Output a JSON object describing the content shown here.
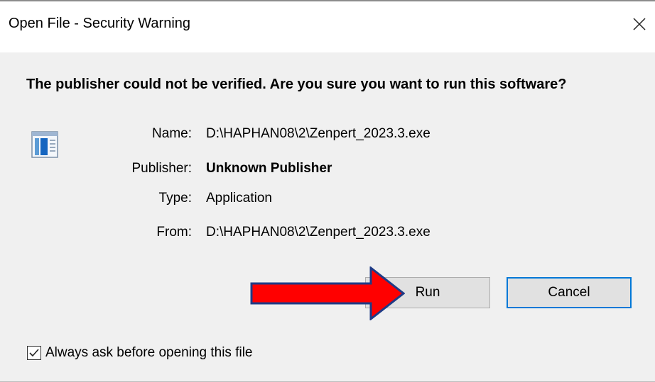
{
  "window": {
    "title": "Open File - Security Warning",
    "close_icon": "close-icon"
  },
  "warning": {
    "headline": "The publisher could not be verified.  Are you sure you want to run this software?"
  },
  "details": {
    "name_label": "Name:",
    "name_value": "D:\\HAPHAN08\\2\\Zenpert_2023.3.exe",
    "publisher_label": "Publisher:",
    "publisher_value": "Unknown Publisher",
    "type_label": "Type:",
    "type_value": "Application",
    "from_label": "From:",
    "from_value": "D:\\HAPHAN08\\2\\Zenpert_2023.3.exe"
  },
  "buttons": {
    "run_label": "Run",
    "cancel_label": "Cancel"
  },
  "checkbox": {
    "label": "Always ask before opening this file",
    "checked": true
  },
  "annotation": {
    "arrow_color": "#ff0000",
    "arrow_outline": "#1f3b86"
  },
  "colors": {
    "focus_border": "#0078d7",
    "dialog_bg": "#f0f0f0"
  }
}
